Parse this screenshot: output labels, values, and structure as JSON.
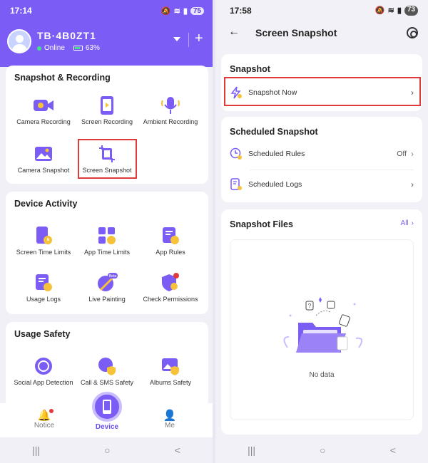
{
  "left": {
    "status": {
      "time": "17:14",
      "battery": "75"
    },
    "profile": {
      "name": "TB·4B0ZT1",
      "status": "Online",
      "battery": "63%"
    },
    "sections": [
      {
        "title": "Snapshot & Recording",
        "items": [
          "Camera Recording",
          "Screen Recording",
          "Ambient Recording",
          "Camera Snapshot",
          "Screen Snapshot"
        ]
      },
      {
        "title": "Device Activity",
        "items": [
          "Screen Time Limits",
          "App Time Limits",
          "App Rules",
          "Usage Logs",
          "Live Painting",
          "Check Permissions"
        ]
      },
      {
        "title": "Usage Safety",
        "items": [
          "Social App Detection",
          "Call & SMS Safety",
          "Albums Safety"
        ]
      }
    ],
    "beta_badge": "Beta",
    "nav": {
      "notice": "Notice",
      "device": "Device",
      "me": "Me"
    },
    "system_nav": {
      "recents": "|||",
      "home": "○",
      "back": "<"
    }
  },
  "right": {
    "status": {
      "time": "17:58",
      "battery": "73"
    },
    "title": "Screen Snapshot",
    "snapshot": {
      "title": "Snapshot",
      "now": "Snapshot Now"
    },
    "scheduled": {
      "title": "Scheduled Snapshot",
      "rules": "Scheduled Rules",
      "rules_value": "Off",
      "logs": "Scheduled Logs"
    },
    "files": {
      "title": "Snapshot Files",
      "all": "All",
      "empty": "No data"
    },
    "system_nav": {
      "recents": "|||",
      "home": "○",
      "back": "<"
    }
  },
  "colors": {
    "accent": "#7b5cf5",
    "highlight": "#e03a3a",
    "icon_yellow": "#f5c23a"
  }
}
